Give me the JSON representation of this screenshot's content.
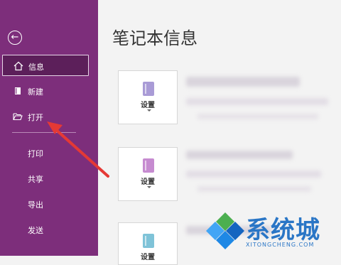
{
  "sidebar": {
    "items": [
      {
        "label": "信息",
        "icon": "home-icon",
        "selected": true
      },
      {
        "label": "新建",
        "icon": "new-notebook-icon",
        "selected": false
      },
      {
        "label": "打开",
        "icon": "folder-open-icon",
        "selected": false
      },
      {
        "label": "打印",
        "selected": false
      },
      {
        "label": "共享",
        "selected": false
      },
      {
        "label": "导出",
        "selected": false
      },
      {
        "label": "发送",
        "selected": false
      }
    ]
  },
  "main": {
    "title": "笔记本信息",
    "notebooks": [
      {
        "settings_label": "设置",
        "icon_color": "#a99bd6"
      },
      {
        "settings_label": "设置",
        "icon_color": "#c68bd0"
      },
      {
        "settings_label": "设置",
        "icon_color": "#7fc3d8"
      }
    ]
  },
  "watermark": {
    "text": "系统城",
    "url": "XITONGCHENG.COM"
  },
  "colors": {
    "sidebar_bg": "#7d2e7b",
    "selected_bg": "#5c1f5a",
    "arrow": "#e53935"
  }
}
